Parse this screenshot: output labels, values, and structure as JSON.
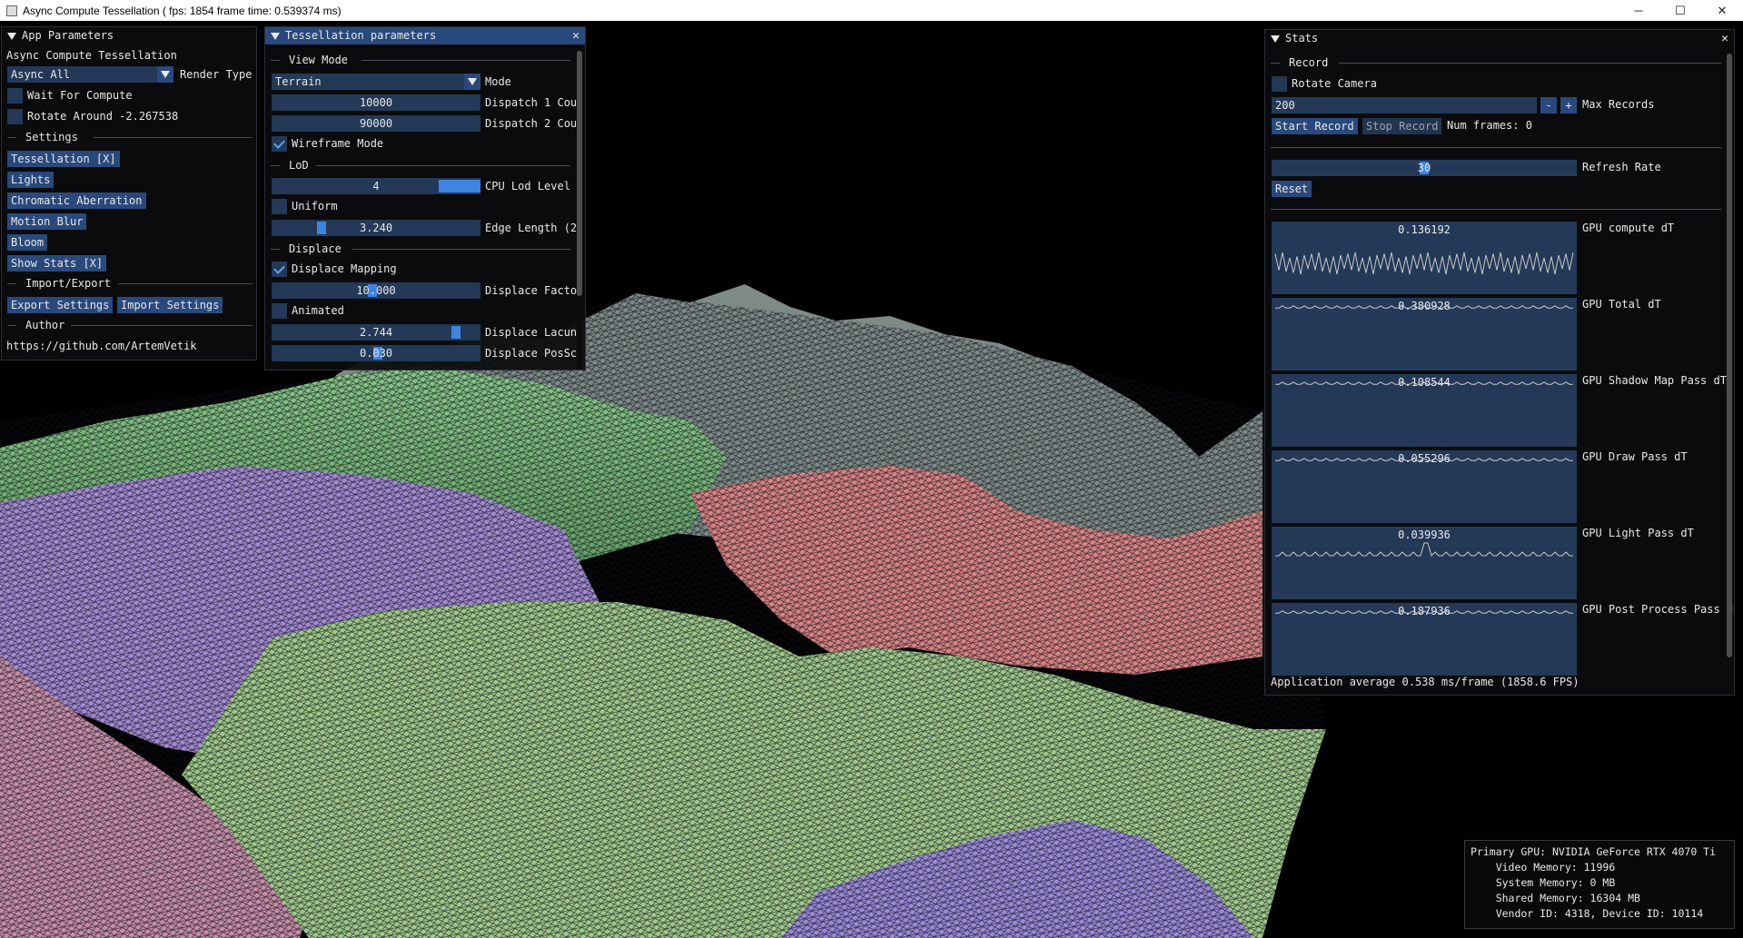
{
  "window": {
    "title": "Async Compute Tessellation ( fps: 1854 frame time: 0.539374 ms)",
    "controls": [
      "─",
      "☐",
      "✕"
    ]
  },
  "app_params": {
    "title": "App Parameters",
    "heading": "Async Compute Tessellation",
    "render_type_value": "Async All",
    "render_type_label": "Render Type",
    "wait_for_compute": "Wait For Compute",
    "rotate_around": "Rotate Around -2.267538",
    "settings_sep": "Settings",
    "buttons": [
      "Tessellation [X]",
      "Lights",
      "Chromatic Aberration",
      "Motion Blur",
      "Bloom",
      "Show Stats [X]"
    ],
    "import_export_sep": "Import/Export",
    "export_btn": "Export Settings",
    "import_btn": "Import Settings",
    "author_sep": "Author",
    "author_link": "https://github.com/ArtemVetik"
  },
  "tess": {
    "title": "Tessellation parameters",
    "view_mode_sep": "View Mode",
    "mode_value": "Terrain",
    "mode_label": "Mode",
    "dispatch1_value": "10000",
    "dispatch1_label": "Dispatch 1 Cou",
    "dispatch2_value": "90000",
    "dispatch2_label": "Dispatch 2 Cou",
    "wireframe": "Wireframe Mode",
    "lod_sep": "LoD",
    "cpu_lod_value": "4",
    "cpu_lod_label": "CPU Lod Level",
    "uniform": "Uniform",
    "edge_value": "3.240",
    "edge_label": "Edge Length (2",
    "displace_sep": "Displace",
    "displace_mapping": "Displace Mapping",
    "displace_factor_value": "10.000",
    "displace_factor_label": "Displace Facto",
    "animated": "Animated",
    "lacun_value": "2.744",
    "lacun_label": "Displace Lacun",
    "possc_value": "0.030",
    "possc_label": "Displace PosSc"
  },
  "stats": {
    "title": "Stats",
    "record_sep": "Record",
    "rotate_camera": "Rotate Camera",
    "max_records_value": "200",
    "minus": "-",
    "plus": "+",
    "max_records_label": "Max Records",
    "start_record": "Start Record",
    "stop_record": "Stop Record",
    "num_frames": "Num frames: 0",
    "refresh_value": "30",
    "refresh_label": "Refresh Rate",
    "reset": "Reset",
    "plots": [
      {
        "value": "0.136192",
        "label": "GPU compute dT"
      },
      {
        "value": "0.380928",
        "label": "GPU Total dT"
      },
      {
        "value": "0.108544",
        "label": "GPU Shadow Map Pass dT"
      },
      {
        "value": "0.055296",
        "label": "GPU Draw Pass dT"
      },
      {
        "value": "0.039936",
        "label": "GPU Light Pass dT"
      },
      {
        "value": "0.187936",
        "label": "GPU Post Process Pass d"
      }
    ],
    "average": "Application average 0.538 ms/frame (1858.6 FPS)"
  },
  "gpu_info": {
    "line1": "Primary GPU: NVIDIA GeForce RTX 4070 Ti",
    "line2": "    Video Memory: 11996",
    "line3": "    System Memory: 0 MB",
    "line4": "    Shared Memory: 16304 MB",
    "line5": "    Vendor ID: 4318, Device ID: 10114"
  },
  "colors": {
    "title_active": "#29497c",
    "frame_bg": "#233957",
    "slider_grab": "#3d85e0",
    "terrain_green": "#6fa86f",
    "terrain_purple": "#9b7fc9",
    "terrain_red": "#d77a7a",
    "terrain_gray": "#6f6f78"
  }
}
